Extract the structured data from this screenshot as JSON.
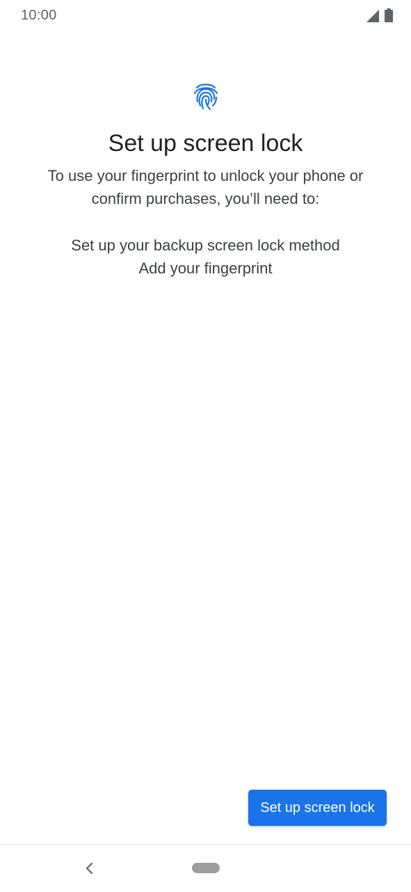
{
  "status_bar": {
    "time": "10:00",
    "icons": [
      "signal-icon",
      "battery-icon"
    ]
  },
  "main": {
    "icon": "fingerprint-icon",
    "title": "Set up screen lock",
    "description": "To use your fingerprint to unlock your phone or confirm purchases, you’ll need to:",
    "steps": [
      "Set up your backup screen lock method",
      "Add your fingerprint"
    ]
  },
  "actions": {
    "primary_label": "Set up screen lock"
  },
  "navigation": {
    "icons": [
      "back-icon",
      "home-pill-icon"
    ]
  },
  "colors": {
    "accent": "#1a73e8",
    "background": "#ffffff",
    "text": "#202124"
  }
}
